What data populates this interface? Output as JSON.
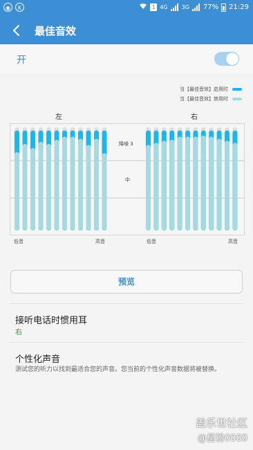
{
  "status_bar": {
    "left_icons": [
      "app-circle-icon",
      "k-circle-icon"
    ],
    "k_glyph": "K",
    "sim_badge": "1",
    "net_1": "4G",
    "net_2": "3G",
    "battery_percent": "77%",
    "time": "21:29"
  },
  "header": {
    "title": "最佳音效",
    "back_icon": "arrow-left-icon",
    "accent_color": "#3c8fd5"
  },
  "toggle": {
    "label": "开",
    "state": true
  },
  "legend": {
    "items": [
      {
        "label": "当【最佳音效】启用时",
        "color": "#1bb6ea"
      },
      {
        "label": "当【最佳音效】禁用时",
        "color": "#a6dae0"
      }
    ]
  },
  "chart": {
    "left_label": "左",
    "right_label": "右",
    "center_top_label": "降噪 3",
    "center_mid_label": "中",
    "left_low": "低音",
    "left_high": "高音",
    "right_low": "低音",
    "right_high": "高音"
  },
  "chart_data": {
    "type": "bar",
    "y_range": [
      0,
      1
    ],
    "series": [
      {
        "name": "当【最佳音效】启用时",
        "color": "#1bb6ea"
      },
      {
        "name": "当【最佳音效】禁用时",
        "color": "#a6dae0"
      }
    ],
    "left": {
      "enabled": [
        0.97,
        0.97,
        0.97,
        0.97,
        0.97,
        0.97,
        0.97,
        0.97,
        0.97,
        0.97,
        0.97,
        0.97
      ],
      "disabled": [
        0.76,
        0.84,
        0.8,
        0.86,
        0.84,
        0.88,
        0.91,
        0.91,
        0.89,
        0.83,
        0.89,
        0.75
      ]
    },
    "right": {
      "enabled": [
        0.97,
        0.97,
        0.97,
        0.97,
        0.97,
        0.97,
        0.97,
        0.97,
        0.97,
        0.97,
        0.97,
        0.97
      ],
      "disabled": [
        0.83,
        0.85,
        0.87,
        0.88,
        0.91,
        0.91,
        0.91,
        0.92,
        0.91,
        0.89,
        0.87,
        0.85
      ]
    }
  },
  "preview_button": "预览",
  "settings": [
    {
      "title": "接听电话时惯用耳",
      "subtitle": "右"
    },
    {
      "title": "个性化声音",
      "description": "测试您的听力以找到最适合您的声音。您当前的个性化声音数据将被替换。"
    }
  ],
  "watermark": {
    "line1": "盖乐世社区",
    "line2": "@星粉0000"
  }
}
